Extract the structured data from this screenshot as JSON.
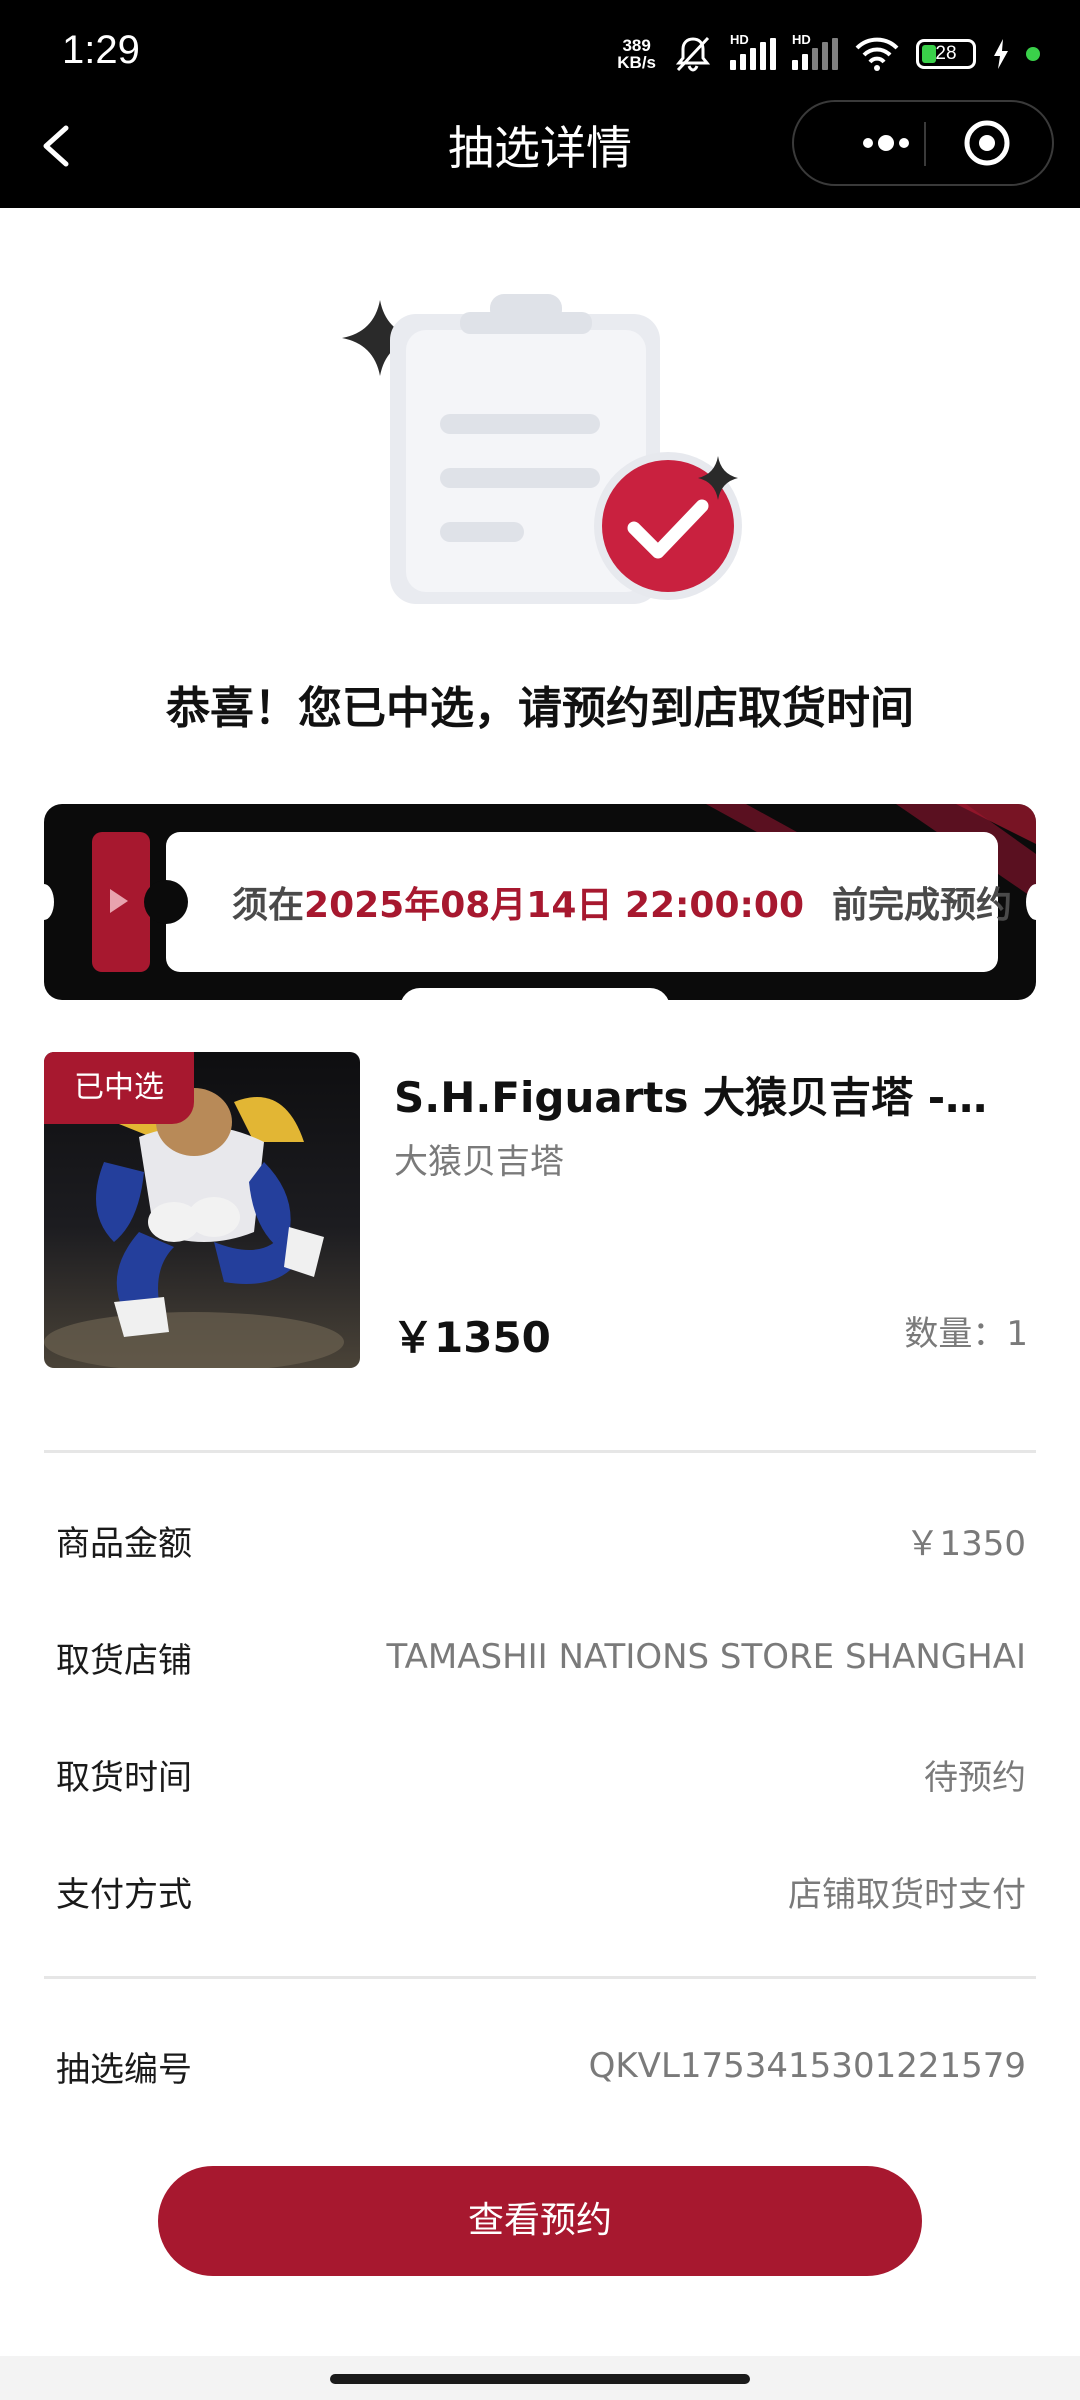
{
  "status_bar": {
    "time": "1:29",
    "net_speed_value": "389",
    "net_speed_unit": "KB/s",
    "signal_1_label": "HD",
    "signal_2_label": "HD",
    "battery": "28",
    "icons": [
      "mute-bell-icon",
      "signal-icon",
      "signal-icon",
      "wifi-icon",
      "battery-icon",
      "charging-icon"
    ]
  },
  "nav": {
    "title": "抽选详情",
    "icons": [
      "back-arrow-icon",
      "more-dots-icon",
      "target-icon"
    ]
  },
  "hero": {
    "message": "恭喜！您已中选，请预约到店取货时间",
    "icon": "clipboard-check-icon"
  },
  "deadline": {
    "prefix": "须在",
    "datetime": "2025年08月14日 22:00:00",
    "suffix": "前完成预约",
    "icon": "play-icon"
  },
  "product": {
    "badge": "已中选",
    "title": "S.H.Figuarts 大猿贝吉塔 -Exclusive Edition-",
    "subtitle": "大猿贝吉塔",
    "price": "￥1350",
    "quantity": "数量：1"
  },
  "details": [
    {
      "label": "商品金额",
      "value": "￥1350"
    },
    {
      "label": "取货店铺",
      "value": "TAMASHII NATIONS STORE SHANGHAI"
    },
    {
      "label": "取货时间",
      "value": "待预约"
    },
    {
      "label": "支付方式",
      "value": "店铺取货时支付"
    }
  ],
  "lottery": {
    "label": "抽选编号",
    "value": "QKVL1753415301221579"
  },
  "action": {
    "label": "查看预约"
  },
  "colors": {
    "accent": "#a7182f",
    "topbar": "#000000",
    "muted_text": "#7a7a7a"
  }
}
